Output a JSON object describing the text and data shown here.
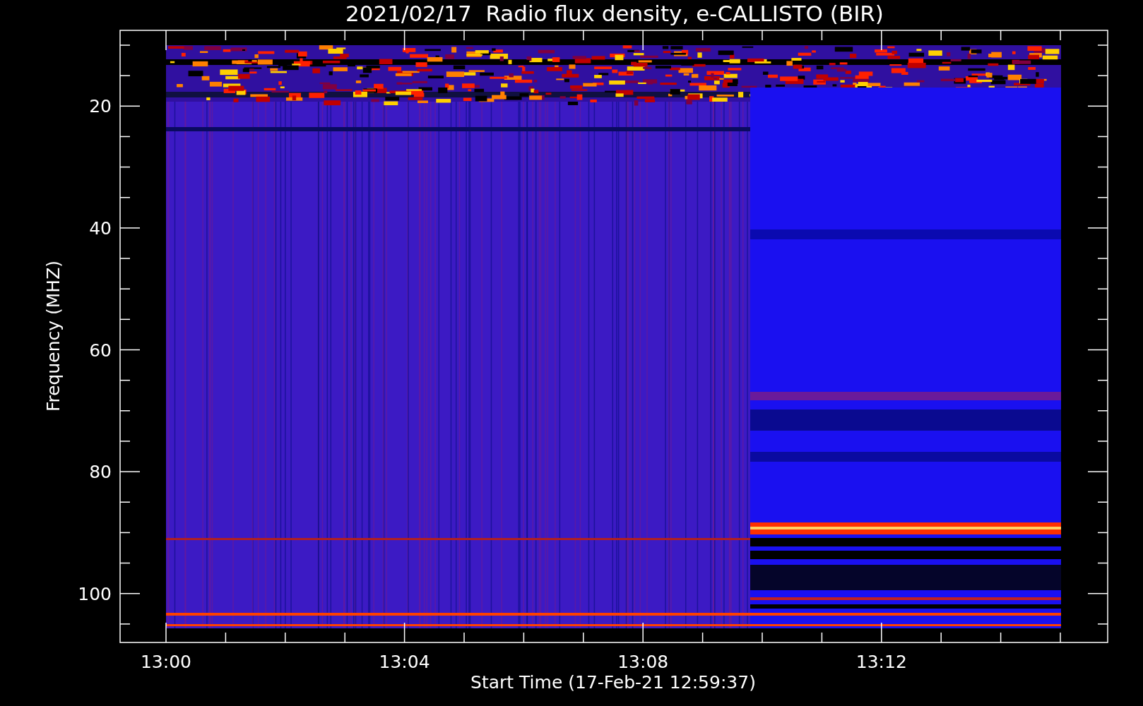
{
  "plot": {
    "title": "2021/02/17  Radio flux density, e-CALLISTO (BIR)",
    "xlabel": "Start Time (17-Feb-21 12:59:37)",
    "ylabel": "Frequency (MHZ)",
    "xtick_labels": [
      "13:00",
      "13:04",
      "13:08",
      "13:12"
    ],
    "ytick_labels": [
      "20",
      "40",
      "60",
      "80",
      "100"
    ]
  }
}
